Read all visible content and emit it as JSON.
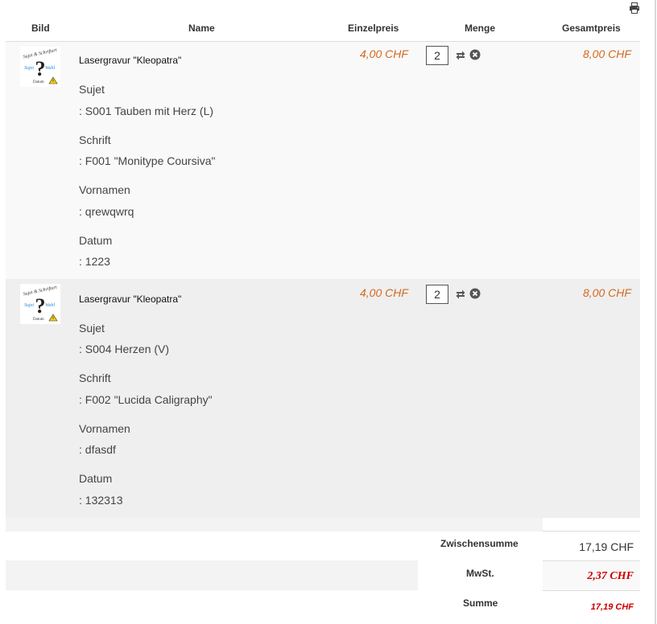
{
  "header": {
    "bild": "Bild",
    "name": "Name",
    "einzelpreis": "Einzelpreis",
    "menge": "Menge",
    "gesamtpreis": "Gesamtpreis"
  },
  "items": [
    {
      "name": "Lasergravur \"Kleopatra\"",
      "unit_price": "4,00 CHF",
      "quantity": "2",
      "total_price": "8,00 CHF",
      "attributes": [
        {
          "label": "Sujet",
          "value": ": S001 Tauben mit Herz (L)"
        },
        {
          "label": "Schrift",
          "value": ": F001 \"Monitype Coursiva\""
        },
        {
          "label": "Vornamen",
          "value": ": qrewqwrq"
        },
        {
          "label": "Datum",
          "value": ": 1223"
        }
      ]
    },
    {
      "name": "Lasergravur \"Kleopatra\"",
      "unit_price": "4,00 CHF",
      "quantity": "2",
      "total_price": "8,00 CHF",
      "attributes": [
        {
          "label": "Sujet",
          "value": ": S004 Herzen (V)"
        },
        {
          "label": "Schrift",
          "value": ": F002 \"Lucida Caligraphy\""
        },
        {
          "label": "Vornamen",
          "value": ": dfasdf"
        },
        {
          "label": "Datum",
          "value": ": 132313"
        }
      ]
    }
  ],
  "totals": {
    "subtotal_label": "Zwischensumme",
    "subtotal_value": "17,19 CHF",
    "tax_label": "MwSt.",
    "tax_value": "2,37 CHF",
    "sum_label": "Summe",
    "sum_value": "17,19 CHF"
  },
  "thumbnail": {
    "line1": "Sujet & Schriftart",
    "line2": "Sujet",
    "line3": "Wahl",
    "line4": "Datum"
  },
  "icons": {
    "print": "printer-icon",
    "update": "refresh-icon",
    "remove": "remove-circle-icon",
    "thumb_warning": "warning-triangle-icon"
  },
  "colors": {
    "price": "#d2691e",
    "tax": "#cc0000",
    "row_odd": "#f9f9f9",
    "row_even": "#efefef"
  }
}
